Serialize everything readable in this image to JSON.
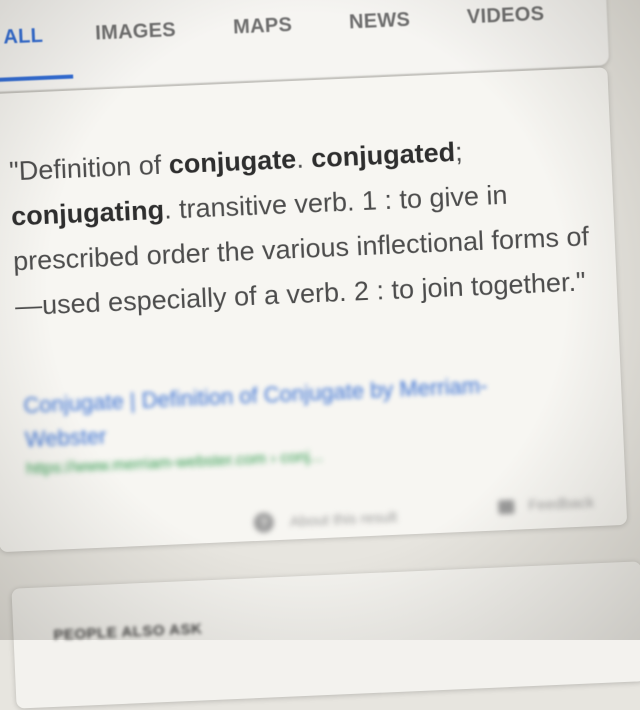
{
  "tabs": [
    {
      "label": "ALL",
      "active": true
    },
    {
      "label": "IMAGES",
      "active": false
    },
    {
      "label": "MAPS",
      "active": false
    },
    {
      "label": "NEWS",
      "active": false
    },
    {
      "label": "VIDEOS",
      "active": false
    }
  ],
  "snippet": {
    "open_quote": "\"",
    "part1": "Definition of ",
    "bold1": "conjugate",
    "part2": ". ",
    "bold2": "conjugated",
    "part3": "; ",
    "bold3": "conjugating",
    "part4": ". transitive verb. 1 : to give in prescribed order the various inflectional forms of —used especially of a verb. 2 : to join together.\""
  },
  "source": {
    "title": "Conjugate | Definition of Conjugate by Merriam-Webster",
    "url": "https://www.merriam-webster.com › conj..."
  },
  "footer": {
    "about_icon": "info-icon",
    "about_label": "About this result",
    "feedback_icon": "feedback-icon",
    "feedback_label": "Feedback"
  },
  "people_also_ask": {
    "title": "PEOPLE ALSO ASK"
  },
  "colors": {
    "accent": "#2f6bd6",
    "link": "#3b72d4",
    "url": "#2e9a4c"
  }
}
